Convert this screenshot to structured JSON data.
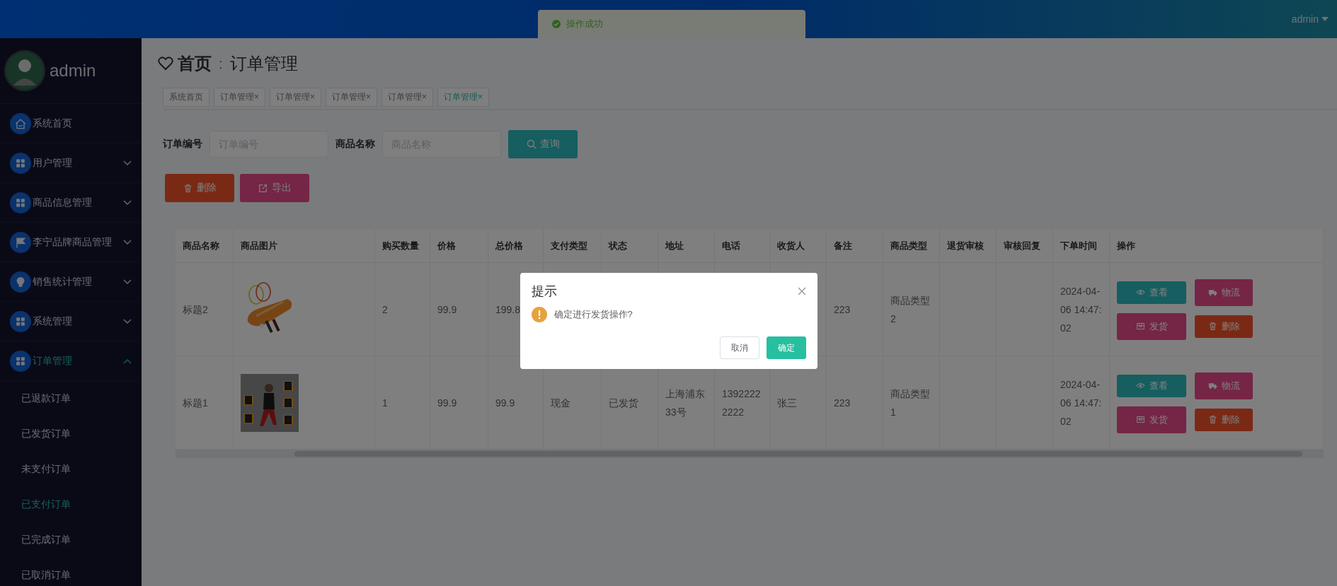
{
  "topbar": {
    "toast": {
      "text": "操作成功"
    },
    "user": "admin"
  },
  "sidebar": {
    "user": "admin",
    "items": [
      {
        "label": "系统首页",
        "kind": "link",
        "selected": false
      },
      {
        "label": "用户管理",
        "kind": "group",
        "selected": false,
        "expanded": false
      },
      {
        "label": "商品信息管理",
        "kind": "group",
        "selected": false,
        "expanded": false
      },
      {
        "label": "李宁品牌商品管理",
        "kind": "group",
        "selected": false,
        "expanded": false
      },
      {
        "label": "销售统计管理",
        "kind": "group",
        "selected": false,
        "expanded": false
      },
      {
        "label": "系统管理",
        "kind": "group",
        "selected": false,
        "expanded": false
      },
      {
        "label": "订单管理",
        "kind": "group",
        "selected": true,
        "expanded": true,
        "children": [
          {
            "label": "已退款订单",
            "selected": false
          },
          {
            "label": "已发货订单",
            "selected": false
          },
          {
            "label": "未支付订单",
            "selected": false
          },
          {
            "label": "已支付订单",
            "selected": true
          },
          {
            "label": "已完成订单",
            "selected": false
          },
          {
            "label": "已取消订单",
            "selected": false
          }
        ]
      }
    ]
  },
  "breadcrumb": {
    "home": "首页",
    "separator": ":",
    "current": "订单管理"
  },
  "tabs": [
    {
      "label": "系统首页",
      "selected": false
    },
    {
      "label": "订单管理",
      "close": "×",
      "selected": false
    },
    {
      "label": "订单管理",
      "close": "×",
      "selected": false
    },
    {
      "label": "订单管理",
      "close": "×",
      "selected": false
    },
    {
      "label": "订单管理",
      "close": "×",
      "selected": false
    },
    {
      "label": "订单管理",
      "close": "×",
      "selected": true
    }
  ],
  "search": {
    "fields": [
      {
        "label": "订单编号",
        "placeholder": "订单编号"
      },
      {
        "label": "商品名称",
        "placeholder": "商品名称"
      }
    ],
    "button": "查询"
  },
  "actions": [
    {
      "label": "删除",
      "kind": "delete"
    },
    {
      "label": "导出",
      "kind": "export"
    }
  ],
  "table": {
    "columns": [
      "商品名称",
      "商品图片",
      "购买数量",
      "价格",
      "总价格",
      "支付类型",
      "状态",
      "地址",
      "电话",
      "收货人",
      "备注",
      "商品类型",
      "退货审核",
      "审核回复",
      "下单时间",
      "操作"
    ],
    "rows": [
      {
        "name": "标题2",
        "qty": "2",
        "price": "99.9",
        "total": "199.8",
        "note": "223",
        "category": "商品类型2",
        "time": "2024-04-06 14:47:02",
        "actions": [
          {
            "label": "查看",
            "kind": "view"
          },
          {
            "label": "物流",
            "kind": "logistics"
          },
          {
            "label": "发货",
            "kind": "ship"
          },
          {
            "label": "删除",
            "kind": "delete"
          }
        ]
      },
      {
        "name": "标题1",
        "qty": "1",
        "price": "99.9",
        "total": "99.9",
        "pay_type": "现金",
        "status": "已发货",
        "address": "上海浦东33号",
        "phone": "13922222222",
        "receiver": "张三",
        "note": "223",
        "category": "商品类型1",
        "time": "2024-04-06 14:47:02",
        "actions": [
          {
            "label": "查看",
            "kind": "view"
          },
          {
            "label": "物流",
            "kind": "logistics"
          },
          {
            "label": "发货",
            "kind": "ship"
          },
          {
            "label": "删除",
            "kind": "delete"
          }
        ]
      }
    ]
  },
  "dialog": {
    "title": "提示",
    "message": "确定进行发货操作?",
    "buttons": [
      {
        "label": "取消",
        "kind": "cancel"
      },
      {
        "label": "确定",
        "kind": "confirm"
      }
    ]
  }
}
